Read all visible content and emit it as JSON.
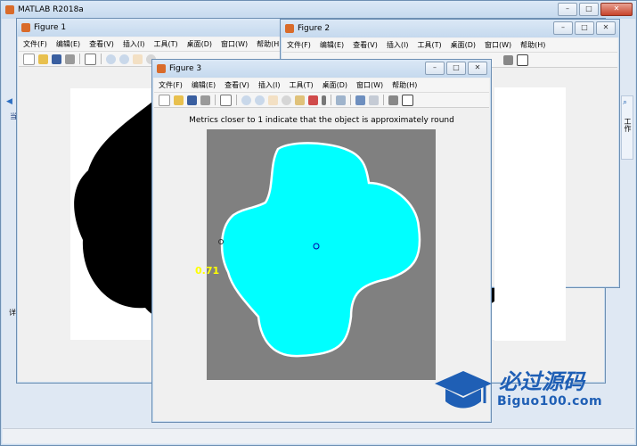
{
  "desktop": {
    "bg_color": "#8fb4d6"
  },
  "matlab": {
    "title": "MATLAB R2018a",
    "side_labels": [
      "当",
      "详",
      "工"
    ],
    "right_label": "工作"
  },
  "figure1": {
    "title": "Figure 1",
    "menu": [
      "文件(F)",
      "编辑(E)",
      "查看(V)",
      "插入(I)",
      "工具(T)",
      "桌面(D)",
      "窗口(W)",
      "帮助(H)"
    ]
  },
  "figure2": {
    "title": "Figure 2",
    "menu": [
      "文件(F)",
      "编辑(E)",
      "查看(V)",
      "插入(I)",
      "工具(T)",
      "桌面(D)",
      "窗口(W)",
      "帮助(H)"
    ]
  },
  "figure3": {
    "title": "Figure 3",
    "menu": [
      "文件(F)",
      "编辑(E)",
      "查看(V)",
      "插入(I)",
      "工具(T)",
      "桌面(D)",
      "窗口(W)",
      "帮助(H)"
    ],
    "plot_title": "Metrics closer to 1 indicate that the object is approximately round",
    "metric_label": "0.71",
    "colors": {
      "shape": "#00ffff",
      "outline": "#ffffff",
      "background": "#808080",
      "label": "#ffff00"
    }
  },
  "watermark": {
    "cn_text": "必过源码",
    "en_text": "Biguo100.com",
    "color": "#1f5fb5"
  }
}
